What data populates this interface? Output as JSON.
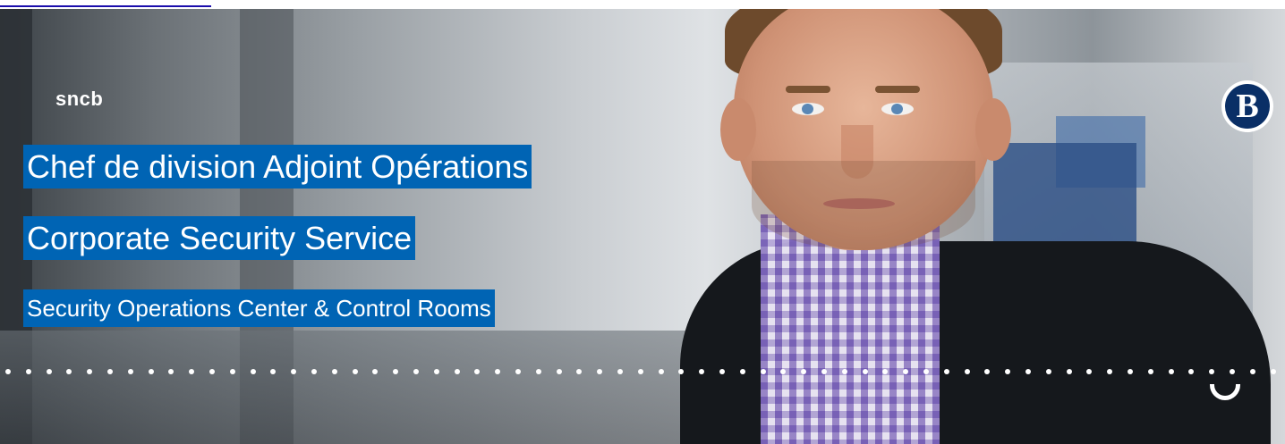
{
  "brand": {
    "wordmark": "sncb",
    "emblem_letter": "B"
  },
  "job": {
    "title": "Chef de division Adjoint Opérations",
    "department": "Corporate Security Service",
    "unit": "Security Operations Center & Control Rooms"
  },
  "colors": {
    "title_background": "#0064b4",
    "title_text": "#ffffff",
    "emblem_navy": "#0a2f66"
  },
  "icons": {
    "smile": "smile-arc-icon"
  }
}
